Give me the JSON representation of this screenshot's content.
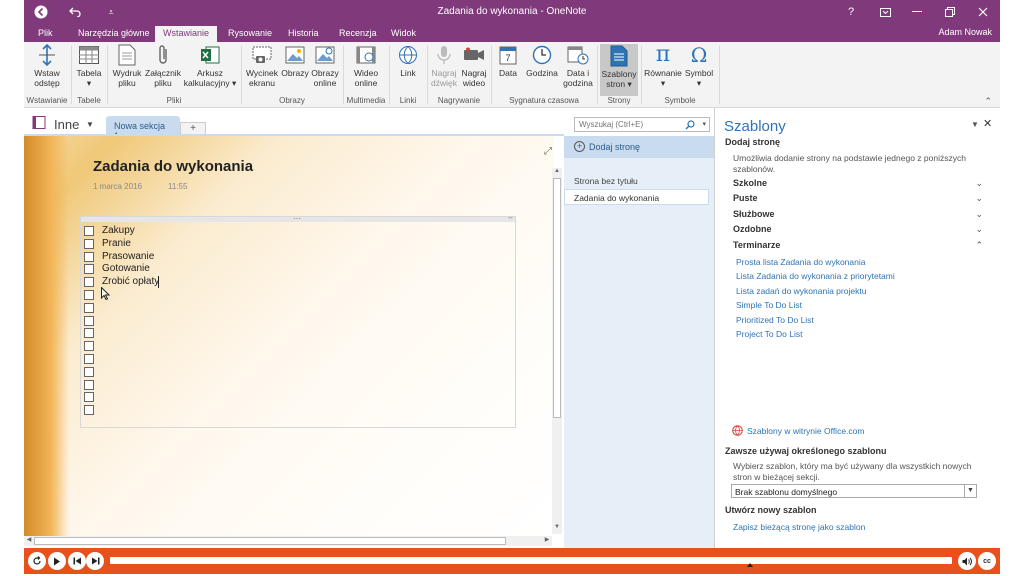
{
  "window": {
    "title": "Zadania do wykonania - OneNote",
    "user": "Adam Nowak"
  },
  "tabs": [
    {
      "label": "Plik"
    },
    {
      "label": "Narzędzia główne"
    },
    {
      "label": "Wstawianie"
    },
    {
      "label": "Rysowanie"
    },
    {
      "label": "Historia"
    },
    {
      "label": "Recenzja"
    },
    {
      "label": "Widok"
    }
  ],
  "ribbon": {
    "buttons": [
      {
        "l1": "Wstaw",
        "l2": "odstęp",
        "icon": "insert-space-icon"
      },
      {
        "l1": "Tabela",
        "l2": "▾",
        "icon": "table-icon"
      },
      {
        "l1": "Wydruk",
        "l2": "pliku",
        "icon": "file-printout-icon"
      },
      {
        "l1": "Załącznik",
        "l2": "pliku",
        "icon": "attachment-icon"
      },
      {
        "l1": "Arkusz",
        "l2": "kalkulacyjny ▾",
        "icon": "excel-icon"
      },
      {
        "l1": "Wycinek",
        "l2": "ekranu",
        "icon": "screen-clipping-icon"
      },
      {
        "l1": "Obrazy",
        "l2": "",
        "icon": "pictures-icon"
      },
      {
        "l1": "Obrazy",
        "l2": "online",
        "icon": "online-pictures-icon"
      },
      {
        "l1": "Wideo",
        "l2": "online",
        "icon": "online-video-icon"
      },
      {
        "l1": "Link",
        "l2": "",
        "icon": "link-icon"
      },
      {
        "l1": "Nagraj",
        "l2": "dźwięk",
        "icon": "record-audio-icon"
      },
      {
        "l1": "Nagraj",
        "l2": "wideo",
        "icon": "record-video-icon"
      },
      {
        "l1": "Data",
        "l2": "",
        "icon": "date-icon"
      },
      {
        "l1": "Godzina",
        "l2": "",
        "icon": "time-icon"
      },
      {
        "l1": "Data i",
        "l2": "godzina",
        "icon": "date-time-icon"
      },
      {
        "l1": "Szablony",
        "l2": "stron ▾",
        "icon": "page-templates-icon"
      },
      {
        "l1": "Równanie",
        "l2": "▾",
        "icon": "equation-icon"
      },
      {
        "l1": "Symbol",
        "l2": "▾",
        "icon": "symbol-icon"
      }
    ],
    "groups": [
      {
        "label": "Wstawianie"
      },
      {
        "label": "Tabele"
      },
      {
        "label": "Pliki"
      },
      {
        "label": "Obrazy"
      },
      {
        "label": "Multimedia"
      },
      {
        "label": "Linki"
      },
      {
        "label": "Nagrywanie"
      },
      {
        "label": "Sygnatura czasowa"
      },
      {
        "label": "Strony"
      },
      {
        "label": "Symbole"
      }
    ]
  },
  "notebook": {
    "name": "Inne",
    "section_tab": "Nowa sekcja 1",
    "add_tab": "+",
    "search_placeholder": "Wyszukaj (Ctrl+E)"
  },
  "page": {
    "title": "Zadania do wykonania",
    "date": "1 marca 2016",
    "time": "11:55",
    "todos": [
      "Zakupy",
      "Pranie",
      "Prasowanie",
      "Gotowanie",
      "Zrobić opłaty"
    ],
    "empty_checkboxes": 10
  },
  "pages_pane": {
    "add_page": "Dodaj stronę",
    "pages": [
      "Strona bez tytułu",
      "Zadania do wykonania"
    ]
  },
  "templates": {
    "title": "Szablony",
    "add_page": "Dodaj stronę",
    "description": "Umożliwia dodanie strony na podstawie jednego z poniższych szablonów.",
    "categories": [
      {
        "label": "Szkolne",
        "chev": "⌄"
      },
      {
        "label": "Puste",
        "chev": "⌄"
      },
      {
        "label": "Służbowe",
        "chev": "⌄"
      },
      {
        "label": "Ozdobne",
        "chev": "⌄"
      },
      {
        "label": "Terminarze",
        "chev": "⌃"
      }
    ],
    "items": [
      "Prosta lista Zadania do wykonania",
      "Lista Zadania do wykonania z priorytetami",
      "Lista zadań do wykonania projektu",
      "Simple To Do List",
      "Prioritized To Do List",
      "Project To Do List"
    ],
    "office_link": "Szablony w witrynie Office.com",
    "always_use_heading": "Zawsze używaj określonego szablonu",
    "always_use_desc": "Wybierz szablon, który ma być używany dla wszystkich nowych stron w bieżącej sekcji.",
    "default_template": "Brak szablonu domyślnego",
    "new_template_heading": "Utwórz nowy szablon",
    "save_as_template": "Zapisz bieżącą stronę jako szablon"
  },
  "colors": {
    "accent": "#80397b",
    "media_bar": "#e8501e",
    "link": "#2e74b5"
  }
}
